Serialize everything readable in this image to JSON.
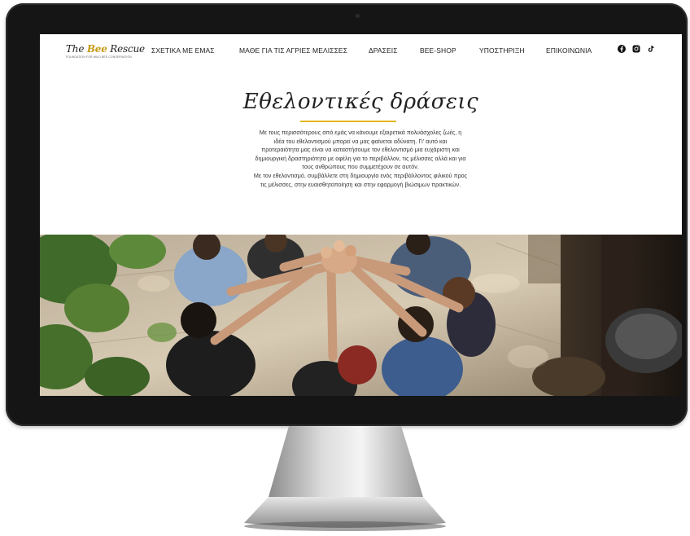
{
  "site": {
    "logo_text_main": "The Bee Rescue",
    "logo_text_sub": "FOUNDATION FOR WILD BEE CONSERVATION"
  },
  "nav": {
    "items": [
      {
        "label": "ΣΧΕΤΙΚΑ ΜΕ ΕΜΑΣ"
      },
      {
        "label": "ΜΑΘΕ ΓΙΑ ΤΙΣ ΑΓΡΙΕΣ ΜΕΛΙΣΣΕΣ"
      },
      {
        "label": "ΔΡΑΣΕΙΣ"
      },
      {
        "label": "BEE-SHOP"
      },
      {
        "label": "ΥΠΟΣΤΗΡΙΞΗ"
      },
      {
        "label": "ΕΠΙΚΟΙΝΩΝΙΑ"
      }
    ],
    "social": [
      {
        "icon": "facebook-icon"
      },
      {
        "icon": "instagram-icon"
      },
      {
        "icon": "tiktok-icon"
      }
    ]
  },
  "hero": {
    "title": "Εθελοντικές δράσεις",
    "paragraph_lines": [
      "Με τους περισσότερους από εμάς να κάνουμε εξαιρετικά πολυάσχολες ζωές, η",
      "ιδέα του εθελοντισμού μπορεί να μας φαίνεται αδύνατη. Γι' αυτό και",
      "προτεραιότητα μας είναι να καταστήσουμε τον εθελοντισμό μια ευχάριστη και",
      "δημιουργική δραστηριότητα με οφέλη για το περιβάλλον, τις μέλισσες αλλά και για",
      "τους ανθρώπους που συμμετέχουν σε αυτόν.",
      "Με τον εθελοντισμό, συμβάλλετε στη δημιουργία ενός περιβάλλοντος φιλικού προς",
      "τις μέλισσες, στην ευαισθητοποίηση και στην εφαρμογή βιώσιμων πρακτικών."
    ]
  },
  "colors": {
    "accent": "#e3b51e",
    "bezel": "#151515"
  }
}
